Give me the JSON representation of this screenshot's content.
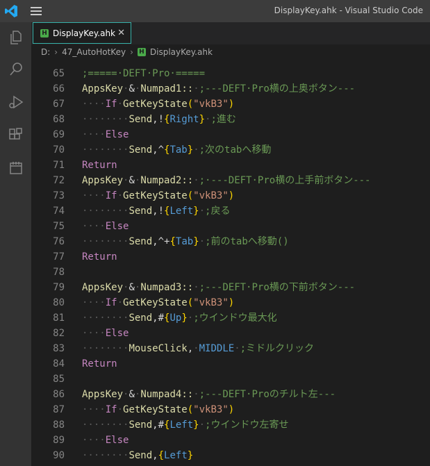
{
  "window": {
    "title": "DisplayKey.ahk - Visual Studio Code"
  },
  "tab": {
    "label": "DisplayKey.ahk",
    "close": "✕",
    "icon": "H"
  },
  "breadcrumb": {
    "drive": "D:",
    "folder": "47_AutoHotKey",
    "file": "DisplayKey.ahk",
    "sep": "›",
    "icon": "H"
  },
  "activity_bar": [
    {
      "name": "explorer-icon"
    },
    {
      "name": "search-icon"
    },
    {
      "name": "run-debug-icon"
    },
    {
      "name": "extensions-icon"
    },
    {
      "name": "calendar-icon"
    }
  ],
  "editor": {
    "lines": [
      {
        "n": "65",
        "segs": [
          {
            "c": "cm",
            "t": ";=====·DEFT·Pro·====="
          }
        ]
      },
      {
        "n": "66",
        "segs": [
          {
            "c": "lbl",
            "t": "AppsKey"
          },
          {
            "c": "w",
            "t": "·"
          },
          {
            "c": "pl",
            "t": "&"
          },
          {
            "c": "w",
            "t": "·"
          },
          {
            "c": "lbl",
            "t": "Numpad1::"
          },
          {
            "c": "w",
            "t": "·"
          },
          {
            "c": "cm",
            "t": ";---DEFT·Pro横の上奥ボタン---"
          }
        ]
      },
      {
        "n": "67",
        "segs": [
          {
            "c": "w",
            "t": "····"
          },
          {
            "c": "kw",
            "t": "If"
          },
          {
            "c": "w",
            "t": "·"
          },
          {
            "c": "fn",
            "t": "GetKeyState"
          },
          {
            "c": "br1",
            "t": "("
          },
          {
            "c": "st",
            "t": "\"vkB3\""
          },
          {
            "c": "br1",
            "t": ")"
          }
        ]
      },
      {
        "n": "68",
        "segs": [
          {
            "c": "w",
            "t": "········"
          },
          {
            "c": "fn",
            "t": "Send"
          },
          {
            "c": "pl",
            "t": ",!"
          },
          {
            "c": "br1",
            "t": "{"
          },
          {
            "c": "var",
            "t": "Right"
          },
          {
            "c": "br1",
            "t": "}"
          },
          {
            "c": "w",
            "t": "·"
          },
          {
            "c": "cm",
            "t": ";進む"
          }
        ]
      },
      {
        "n": "69",
        "segs": [
          {
            "c": "w",
            "t": "····"
          },
          {
            "c": "kw",
            "t": "Else"
          }
        ]
      },
      {
        "n": "70",
        "segs": [
          {
            "c": "w",
            "t": "········"
          },
          {
            "c": "fn",
            "t": "Send"
          },
          {
            "c": "pl",
            "t": ",^"
          },
          {
            "c": "br1",
            "t": "{"
          },
          {
            "c": "var",
            "t": "Tab"
          },
          {
            "c": "br1",
            "t": "}"
          },
          {
            "c": "w",
            "t": "·"
          },
          {
            "c": "cm",
            "t": ";次のtabへ移動"
          }
        ]
      },
      {
        "n": "71",
        "segs": [
          {
            "c": "kw",
            "t": "Return"
          }
        ]
      },
      {
        "n": "72",
        "segs": [
          {
            "c": "lbl",
            "t": "AppsKey"
          },
          {
            "c": "w",
            "t": "·"
          },
          {
            "c": "pl",
            "t": "&"
          },
          {
            "c": "w",
            "t": "·"
          },
          {
            "c": "lbl",
            "t": "Numpad2::"
          },
          {
            "c": "w",
            "t": "·"
          },
          {
            "c": "cm",
            "t": ";·---DEFT·Pro横の上手前ボタン---"
          }
        ]
      },
      {
        "n": "73",
        "segs": [
          {
            "c": "w",
            "t": "····"
          },
          {
            "c": "kw",
            "t": "If"
          },
          {
            "c": "w",
            "t": "·"
          },
          {
            "c": "fn",
            "t": "GetKeyState"
          },
          {
            "c": "br1",
            "t": "("
          },
          {
            "c": "st",
            "t": "\"vkB3\""
          },
          {
            "c": "br1",
            "t": ")"
          }
        ]
      },
      {
        "n": "74",
        "segs": [
          {
            "c": "w",
            "t": "········"
          },
          {
            "c": "fn",
            "t": "Send"
          },
          {
            "c": "pl",
            "t": ",!"
          },
          {
            "c": "br1",
            "t": "{"
          },
          {
            "c": "var",
            "t": "Left"
          },
          {
            "c": "br1",
            "t": "}"
          },
          {
            "c": "w",
            "t": "·"
          },
          {
            "c": "cm",
            "t": ";戻る"
          }
        ]
      },
      {
        "n": "75",
        "segs": [
          {
            "c": "w",
            "t": "····"
          },
          {
            "c": "kw",
            "t": "Else"
          }
        ]
      },
      {
        "n": "76",
        "segs": [
          {
            "c": "w",
            "t": "········"
          },
          {
            "c": "fn",
            "t": "Send"
          },
          {
            "c": "pl",
            "t": ",^+"
          },
          {
            "c": "br1",
            "t": "{"
          },
          {
            "c": "var",
            "t": "Tab"
          },
          {
            "c": "br1",
            "t": "}"
          },
          {
            "c": "w",
            "t": "·"
          },
          {
            "c": "cm",
            "t": ";前のtabへ移動()"
          }
        ]
      },
      {
        "n": "77",
        "segs": [
          {
            "c": "kw",
            "t": "Return"
          }
        ]
      },
      {
        "n": "78",
        "segs": []
      },
      {
        "n": "79",
        "segs": [
          {
            "c": "lbl",
            "t": "AppsKey"
          },
          {
            "c": "w",
            "t": "·"
          },
          {
            "c": "pl",
            "t": "&"
          },
          {
            "c": "w",
            "t": "·"
          },
          {
            "c": "lbl",
            "t": "Numpad3::"
          },
          {
            "c": "w",
            "t": "·"
          },
          {
            "c": "cm",
            "t": ";---DEFT·Pro横の下前ボタン---"
          }
        ]
      },
      {
        "n": "80",
        "segs": [
          {
            "c": "w",
            "t": "····"
          },
          {
            "c": "kw",
            "t": "If"
          },
          {
            "c": "w",
            "t": "·"
          },
          {
            "c": "fn",
            "t": "GetKeyState"
          },
          {
            "c": "br1",
            "t": "("
          },
          {
            "c": "st",
            "t": "\"vkB3\""
          },
          {
            "c": "br1",
            "t": ")"
          }
        ]
      },
      {
        "n": "81",
        "segs": [
          {
            "c": "w",
            "t": "········"
          },
          {
            "c": "fn",
            "t": "Send"
          },
          {
            "c": "pl",
            "t": ",#"
          },
          {
            "c": "br1",
            "t": "{"
          },
          {
            "c": "var",
            "t": "Up"
          },
          {
            "c": "br1",
            "t": "}"
          },
          {
            "c": "w",
            "t": "·"
          },
          {
            "c": "cm",
            "t": ";ウインドウ最大化"
          }
        ]
      },
      {
        "n": "82",
        "segs": [
          {
            "c": "w",
            "t": "····"
          },
          {
            "c": "kw",
            "t": "Else"
          }
        ]
      },
      {
        "n": "83",
        "segs": [
          {
            "c": "w",
            "t": "········"
          },
          {
            "c": "fn",
            "t": "MouseClick"
          },
          {
            "c": "pl",
            "t": ","
          },
          {
            "c": "w",
            "t": "·"
          },
          {
            "c": "var",
            "t": "MIDDLE"
          },
          {
            "c": "w",
            "t": "·"
          },
          {
            "c": "cm",
            "t": ";ミドルクリック"
          }
        ]
      },
      {
        "n": "84",
        "segs": [
          {
            "c": "kw",
            "t": "Return"
          }
        ]
      },
      {
        "n": "85",
        "segs": []
      },
      {
        "n": "86",
        "segs": [
          {
            "c": "lbl",
            "t": "AppsKey"
          },
          {
            "c": "w",
            "t": "·"
          },
          {
            "c": "pl",
            "t": "&"
          },
          {
            "c": "w",
            "t": "·"
          },
          {
            "c": "lbl",
            "t": "Numpad4::"
          },
          {
            "c": "w",
            "t": "·"
          },
          {
            "c": "cm",
            "t": ";---DEFT·Proのチルト左---"
          }
        ]
      },
      {
        "n": "87",
        "segs": [
          {
            "c": "w",
            "t": "····"
          },
          {
            "c": "kw",
            "t": "If"
          },
          {
            "c": "w",
            "t": "·"
          },
          {
            "c": "fn",
            "t": "GetKeyState"
          },
          {
            "c": "br1",
            "t": "("
          },
          {
            "c": "st",
            "t": "\"vkB3\""
          },
          {
            "c": "br1",
            "t": ")"
          }
        ]
      },
      {
        "n": "88",
        "segs": [
          {
            "c": "w",
            "t": "········"
          },
          {
            "c": "fn",
            "t": "Send"
          },
          {
            "c": "pl",
            "t": ",#"
          },
          {
            "c": "br1",
            "t": "{"
          },
          {
            "c": "var",
            "t": "Left"
          },
          {
            "c": "br1",
            "t": "}"
          },
          {
            "c": "w",
            "t": "·"
          },
          {
            "c": "cm",
            "t": ";ウインドウ左寄せ"
          }
        ]
      },
      {
        "n": "89",
        "segs": [
          {
            "c": "w",
            "t": "····"
          },
          {
            "c": "kw",
            "t": "Else"
          }
        ]
      },
      {
        "n": "90",
        "segs": [
          {
            "c": "w",
            "t": "········"
          },
          {
            "c": "fn",
            "t": "Send"
          },
          {
            "c": "pl",
            "t": ","
          },
          {
            "c": "br1",
            "t": "{"
          },
          {
            "c": "var",
            "t": "Left"
          },
          {
            "c": "br1",
            "t": "}"
          }
        ]
      }
    ]
  }
}
